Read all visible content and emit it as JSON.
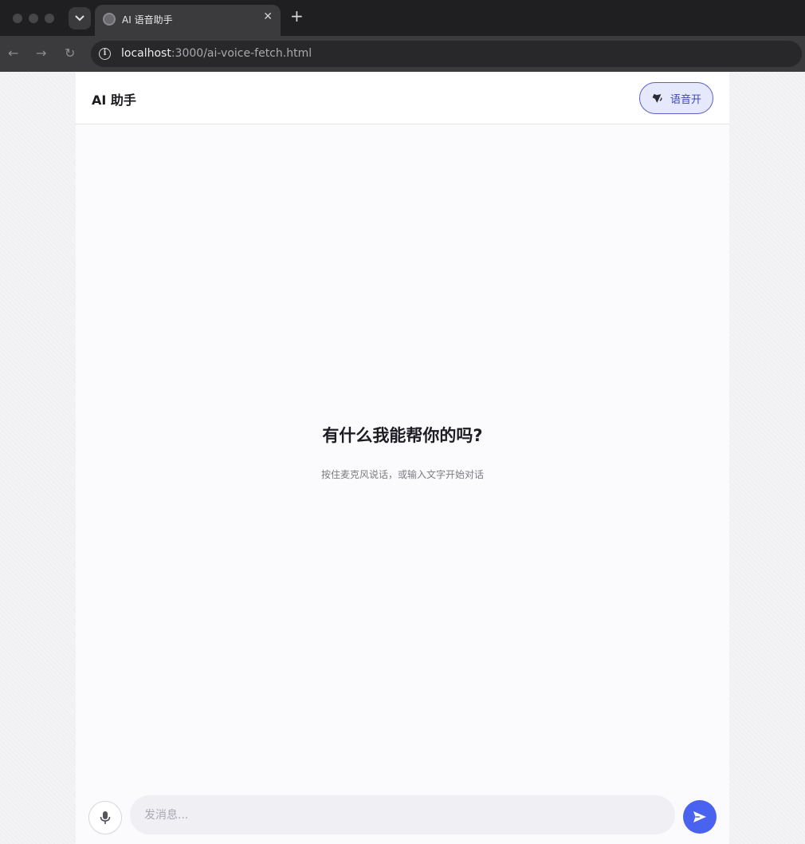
{
  "browser": {
    "tab_title": "AI 语音助手",
    "tab_close": "✕",
    "new_tab": "+",
    "url_host": "localhost",
    "url_path": ":3000/ai-voice-fetch.html",
    "back": "←",
    "forward": "→",
    "reload": "↻",
    "info": "i"
  },
  "header": {
    "title": "AI 助手",
    "voice_toggle_label": "语音开"
  },
  "empty_state": {
    "title": "有什么我能帮你的吗?",
    "subtitle": "按住麦克风说话，或输入文字开始对话"
  },
  "composer": {
    "placeholder": "发消息..."
  },
  "colors": {
    "accent": "#4a62f0",
    "toggle_border": "#5a63c9",
    "toggle_bg": "#e6e8fb"
  },
  "icons": {
    "mic": "mic-icon",
    "send": "send-icon",
    "speaker": "speaker-icon",
    "globe": "globe-icon"
  }
}
